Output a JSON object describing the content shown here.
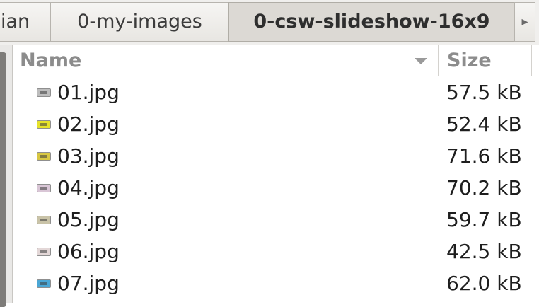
{
  "pathbar": {
    "crumbs": [
      "ian",
      "0-my-images",
      "0-csw-slideshow-16x9"
    ],
    "scroll_glyph": "▸"
  },
  "columns": {
    "name": "Name",
    "size": "Size"
  },
  "files": [
    {
      "name": "01.jpg",
      "size": "57.5 kB",
      "icon": "image-thumbnail-icon",
      "color": "#bdbdbd"
    },
    {
      "name": "02.jpg",
      "size": "52.4 kB",
      "icon": "image-thumbnail-icon",
      "color": "#e6e22a"
    },
    {
      "name": "03.jpg",
      "size": "71.6 kB",
      "icon": "image-thumbnail-icon",
      "color": "#d8c742"
    },
    {
      "name": "04.jpg",
      "size": "70.2 kB",
      "icon": "image-thumbnail-icon",
      "color": "#d9c6d6"
    },
    {
      "name": "05.jpg",
      "size": "59.7 kB",
      "icon": "image-thumbnail-icon",
      "color": "#c9c3a8"
    },
    {
      "name": "06.jpg",
      "size": "42.5 kB",
      "icon": "image-thumbnail-icon",
      "color": "#e3d7d7"
    },
    {
      "name": "07.jpg",
      "size": "62.0 kB",
      "icon": "image-thumbnail-icon",
      "color": "#4aa7d6"
    }
  ]
}
